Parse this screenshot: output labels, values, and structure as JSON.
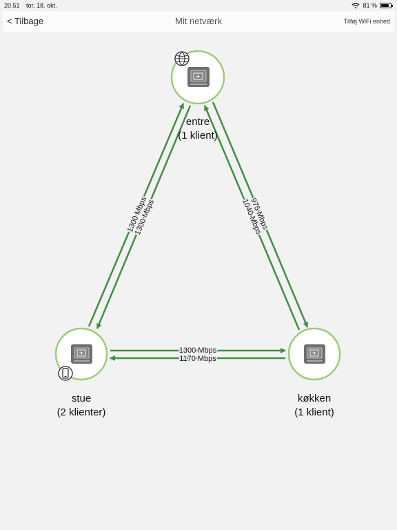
{
  "status_bar": {
    "time": "20.51",
    "date": "tor. 18. okt.",
    "battery": "81 %",
    "battery_level": 0.81
  },
  "nav": {
    "back_label": "< Tilbage",
    "title": "Mit netværk",
    "add_label": "Tilføj WiFi enhed"
  },
  "nodes": {
    "entre": {
      "name": "entre",
      "clients": "(1 klient)",
      "badge": "globe-icon"
    },
    "stue": {
      "name": "stue",
      "clients": "(2 klienter)",
      "badge": "phone-icon"
    },
    "kokken": {
      "name": "køkken",
      "clients": "(1 klient)"
    }
  },
  "links": {
    "entre_stue": {
      "a": "1300 Mbps",
      "b": "1300 Mbps"
    },
    "entre_kokken": {
      "a": "975 Mbps",
      "b": "1040 Mbps"
    },
    "stue_kokken": {
      "a": "1300 Mbps",
      "b": "1170 Mbps"
    }
  },
  "colors": {
    "link_green": "#3f8f3f",
    "node_ring": "#9ccc74",
    "router_gray": "#6f6f6f"
  }
}
